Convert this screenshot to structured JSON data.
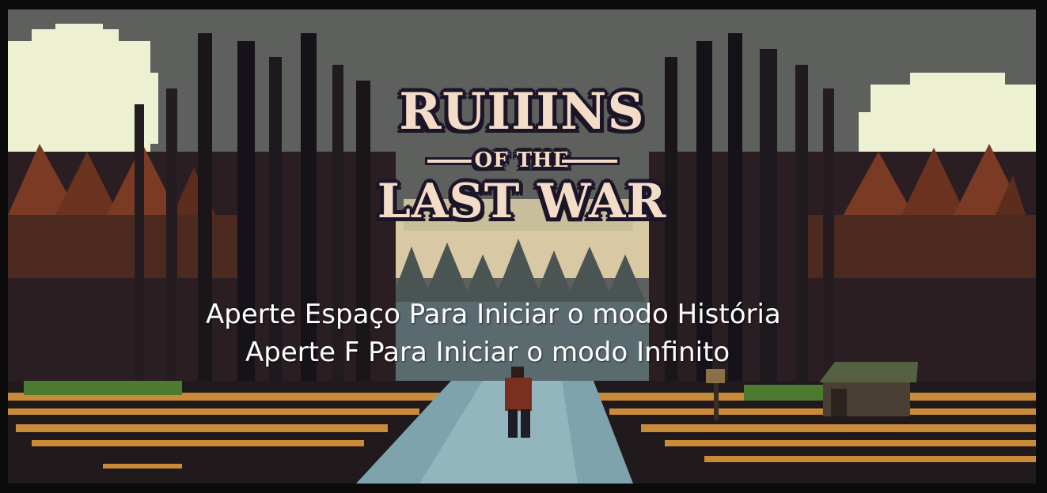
{
  "logo": {
    "line1": "RUIIINS",
    "line2": "OF THE",
    "line3": "LAST WAR"
  },
  "prompts": {
    "story": "Aperte Espaço Para Iniciar o modo História",
    "infinite": "Aperte F Para Iniciar o modo Infinito"
  },
  "colors": {
    "sky": "#5b5e5b",
    "forest_dark": "#1b1720",
    "foliage_rust": "#7a3a24",
    "grass": "#c98a3a",
    "water": "#7fa3ad",
    "logo_text": "#f4ddc8",
    "logo_outline": "#1c1528",
    "prompt_text": "#ffffff"
  }
}
